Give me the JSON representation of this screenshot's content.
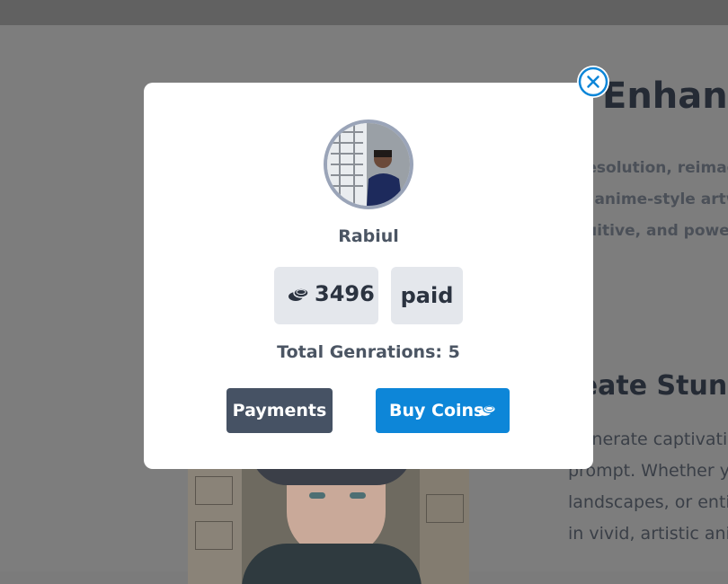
{
  "background": {
    "hero_title": "Enhanc",
    "hero_lines": [
      "resolution, reimag",
      "e anime-style artwo",
      "tuitive, and powerfu"
    ],
    "section_title": "reate Stunn",
    "section_lines": [
      "Generate captivating",
      "prompt. Whether yo",
      "landscapes, or entire",
      "in vivid, artistic anim"
    ]
  },
  "modal": {
    "username": "Rabiul",
    "coins": "3496",
    "plan": "paid",
    "total_generations": "Total Genrations: 5",
    "payments_label": "Payments",
    "buy_coins_label": "Buy Coins"
  },
  "icons": {
    "close": "close-circle-icon",
    "coins": "coins-icon"
  },
  "colors": {
    "primary": "#0d86d8",
    "secondary": "#465264",
    "overlay": "#7d7d7d"
  }
}
